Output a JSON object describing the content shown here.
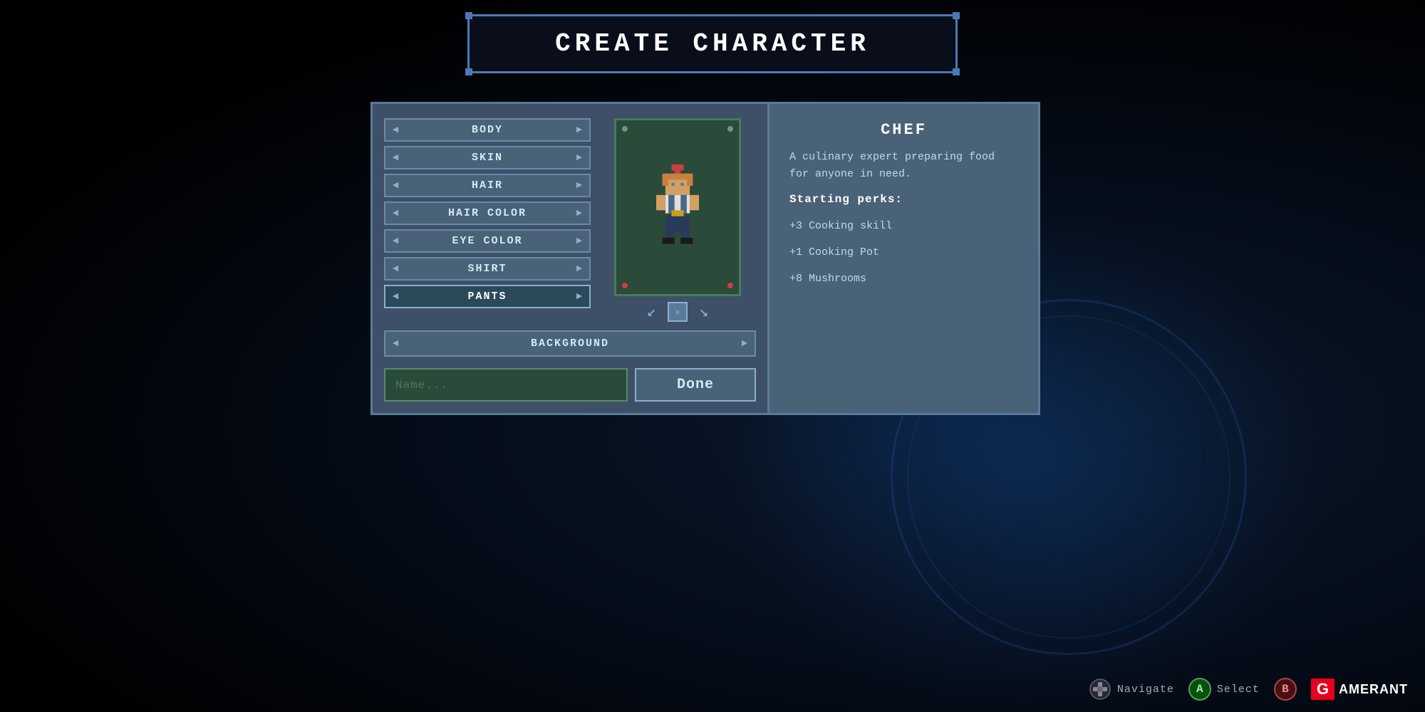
{
  "title": "CREATE CHARACTER",
  "options": [
    {
      "label": "BODY",
      "selected": false
    },
    {
      "label": "SKIN",
      "selected": false
    },
    {
      "label": "HAIR",
      "selected": false
    },
    {
      "label": "HAIR COLOR",
      "selected": false
    },
    {
      "label": "EYE COLOR",
      "selected": false
    },
    {
      "label": "SHIRT",
      "selected": false
    },
    {
      "label": "PANTS",
      "selected": true
    }
  ],
  "background_option": {
    "label": "BACKGROUND"
  },
  "name_input": {
    "placeholder": "Name...",
    "value": ""
  },
  "done_button": "Done",
  "character_class": {
    "name": "CHEF",
    "description": "A culinary expert preparing food for anyone in need.",
    "perks_title": "Starting perks:",
    "perks": [
      "+3 Cooking skill",
      "+1 Cooking Pot",
      "+8 Mushrooms"
    ]
  },
  "controls": [
    {
      "icon": "navigate",
      "label": "Navigate"
    },
    {
      "icon": "A",
      "label": "Select"
    },
    {
      "icon": "B",
      "label": ""
    }
  ],
  "branding": {
    "site": "GAMERANT"
  }
}
